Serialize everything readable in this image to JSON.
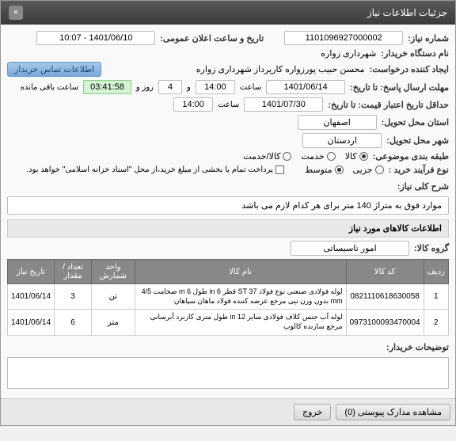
{
  "window": {
    "title": "جزئیات اطلاعات نیاز"
  },
  "form": {
    "need_no_label": "شماره نیاز:",
    "need_no": "1101096927000002",
    "announce_label": "تاریخ و ساعت اعلان عمومی:",
    "announce": "1401/06/10 - 10:07",
    "buyer_org_label": "نام دستگاه خریدار:",
    "buyer_org": "شهرداری زواره",
    "requester_label": "ایجاد کننده درخواست:",
    "requester": "محسن حبیب پورزواره کارپرداز شهرداری زواره",
    "contact_btn": "اطلاعات تماس خریدار",
    "deadline_label": "مهلت ارسال پاسخ: تا تاریخ:",
    "deadline_date": "1401/06/14",
    "time_label": "ساعت",
    "deadline_time": "14:00",
    "and_label": "و",
    "days": "4",
    "day_label": "روز و",
    "countdown": "03:41:58",
    "remaining_label": "ساعت باقی مانده",
    "validity_label": "حداقل تاریخ اعتبار قیمت: تا تاریخ:",
    "validity_date": "1401/07/30",
    "validity_time": "14:00",
    "province_label": "استان محل تحویل:",
    "province": "اصفهان",
    "city_label": "شهر محل تحویل:",
    "city": "اردستان",
    "category_label": "طبقه بندی موضوعی:",
    "cat_goods": "کالا",
    "cat_service": "خدمت",
    "cat_both": "کالا/خدمت",
    "process_label": "نوع فرآیند خرید :",
    "proc_small": "جزیی",
    "proc_medium": "متوسط",
    "payment_note": "پرداخت تمام یا بخشی از مبلغ خرید،از محل \"اسناد خزانه اسلامی\" خواهد بود."
  },
  "desc": {
    "label": "شرح کلی نیاز:",
    "text": "موارد فوق به متراژ 140 متر برای هر کدام لازم می باشد"
  },
  "goods": {
    "header": "اطلاعات کالاهای مورد نیاز",
    "group_label": "گروه کالا:",
    "group": "امور تاسیساتی",
    "cols": {
      "row": "ردیف",
      "code": "کد کالا",
      "name": "نام کالا",
      "unit": "واحد شمارش",
      "qty": "تعداد / مقدار",
      "date": "تاریخ نیاز"
    },
    "rows": [
      {
        "idx": "1",
        "code": "0821110618630058",
        "name": "لوله فولادی صنعتی نوع فولاد ST 37 قطر 6 in طول 6 m ضخامت 4/5 mm بدون وزن نیی مرجع عرضه کننده فولاد ماهان سپاهان",
        "unit": "تن",
        "qty": "3",
        "date": "1401/06/14"
      },
      {
        "idx": "2",
        "code": "0973100093470004",
        "name": "لوله آب جنس کلاف فولادی سایز 12 in طول متری کاربرد آبرسانی مرجع سازنده کالوپ",
        "unit": "متر",
        "qty": "6",
        "date": "1401/06/14"
      }
    ]
  },
  "notes": {
    "label": "توضیحات خریدار:"
  },
  "footer": {
    "attachments": "مشاهده مدارک پیوستی (0)",
    "close": "خروج"
  }
}
